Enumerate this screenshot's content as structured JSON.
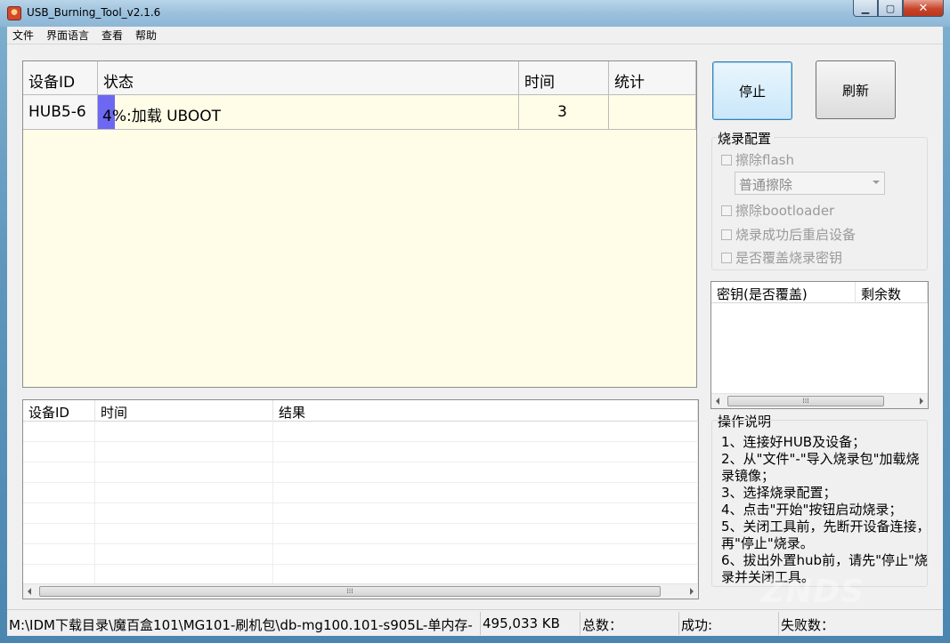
{
  "window": {
    "title": "USB_Burning_Tool_v2.1.6"
  },
  "menu": [
    "文件",
    "界面语言",
    "查看",
    "帮助"
  ],
  "device_grid": {
    "headers": [
      "设备ID",
      "状态",
      "时间",
      "统计"
    ],
    "rows": [
      {
        "device_id": "HUB5-6",
        "status": "4%:加载 UBOOT",
        "progress_percent": 4,
        "time": "3",
        "stat": ""
      }
    ]
  },
  "buttons": {
    "stop": "停止",
    "refresh": "刷新"
  },
  "burn_config": {
    "title": "烧录配置",
    "erase_flash": "擦除flash",
    "erase_mode": "普通擦除",
    "erase_bootloader": "擦除bootloader",
    "reboot_after": "烧录成功后重启设备",
    "overwrite_key": "是否覆盖烧录密钥"
  },
  "key_list": {
    "headers": [
      "密钥(是否覆盖)",
      "剩余数"
    ]
  },
  "instructions": {
    "title": "操作说明",
    "text": "1、连接好HUB及设备；\n2、从\"文件\"-\"导入烧录包\"加载烧录镜像；\n3、选择烧录配置；\n4、点击\"开始\"按钮启动烧录；\n5、关闭工具前，先断开设备连接，再\"停止\"烧录。\n6、拔出外置hub前，请先\"停止\"烧录并关闭工具。"
  },
  "log_grid": {
    "headers": [
      "设备ID",
      "时间",
      "结果"
    ]
  },
  "status_bar": {
    "path": "M:\\IDM下载目录\\魔百盒101\\MG101-刷机包\\db-mg100.101-s905L-单内存-",
    "size": "495,033 KB",
    "total": "总数：",
    "success": "成功:",
    "fail": "失败数："
  },
  "watermark": "ZNDS"
}
